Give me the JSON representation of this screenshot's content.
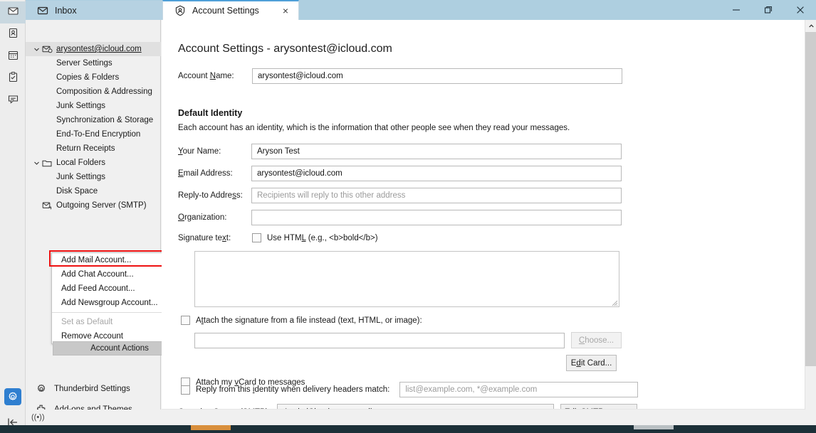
{
  "window": {
    "controls": {
      "minimize": "minimize-icon",
      "maximize": "restore-icon",
      "close": "close-icon"
    }
  },
  "tabs": [
    {
      "label": "Inbox",
      "icon": "inbox-icon",
      "active": false
    },
    {
      "label": "Account Settings",
      "icon": "account-settings-icon",
      "active": true,
      "close": "×"
    }
  ],
  "rail": {
    "top_items": [
      {
        "name": "mail-icon",
        "title": "Mail"
      },
      {
        "name": "address-book-icon",
        "title": "Address Book"
      },
      {
        "name": "calendar-icon",
        "title": "Calendar"
      },
      {
        "name": "tasks-icon",
        "title": "Tasks"
      },
      {
        "name": "chat-icon",
        "title": "Chat"
      }
    ],
    "bottom_items": [
      {
        "name": "settings-gear-icon",
        "title": "Settings"
      },
      {
        "name": "collapse-icon",
        "title": "Collapse"
      }
    ]
  },
  "sidebar": {
    "tree": [
      {
        "label": "arysontest@icloud.com",
        "level": 1,
        "twisty": "v",
        "icon": "account-icon",
        "selected": true,
        "underline": true
      },
      {
        "label": "Server Settings",
        "level": 2
      },
      {
        "label": "Copies & Folders",
        "level": 2
      },
      {
        "label": "Composition & Addressing",
        "level": 2
      },
      {
        "label": "Junk Settings",
        "level": 2
      },
      {
        "label": "Synchronization & Storage",
        "level": 2
      },
      {
        "label": "End-To-End Encryption",
        "level": 2
      },
      {
        "label": "Return Receipts",
        "level": 2
      },
      {
        "label": "Local Folders",
        "level": 1,
        "twisty": "v",
        "icon": "folder-icon"
      },
      {
        "label": "Junk Settings",
        "level": 2
      },
      {
        "label": "Disk Space",
        "level": 2
      },
      {
        "label": "Outgoing Server (SMTP)",
        "level": 1,
        "icon": "smtp-icon"
      }
    ],
    "menu": {
      "items": [
        {
          "label": "Add Mail Account...",
          "accel": "A",
          "disabled": false,
          "highlighted": true
        },
        {
          "label": "Add Chat Account...",
          "accel": "C",
          "disabled": false
        },
        {
          "label": "Add Feed Account...",
          "accel": "F",
          "disabled": false
        },
        {
          "label": "Add Newsgroup Account...",
          "accel": "N",
          "disabled": false
        },
        {
          "separator": true
        },
        {
          "label": "Set as Default",
          "accel": "D",
          "disabled": true
        },
        {
          "label": "Remove Account",
          "accel": "R",
          "disabled": false
        }
      ],
      "highlight_color": "#ee1111"
    },
    "account_actions_button": {
      "label": "Account Actions",
      "caret": "chevron-down-icon"
    },
    "bottom_links": [
      {
        "label": "Thunderbird Settings",
        "icon": "gear-icon"
      },
      {
        "label": "Add-ons and Themes",
        "icon": "puzzle-icon"
      }
    ]
  },
  "main": {
    "heading": "Account Settings - arysontest@icloud.com",
    "account_name": {
      "label_pre": "Account ",
      "label_accel": "N",
      "label_post": "ame:",
      "value": "arysontest@icloud.com"
    },
    "default_identity": {
      "title": "Default Identity",
      "description": "Each account has an identity, which is the information that other people see when they read your messages.",
      "fields": [
        {
          "label_pre": "",
          "label_accel": "Y",
          "label_post": "our Name:",
          "value": "Aryson Test",
          "placeholder": ""
        },
        {
          "label_pre": "",
          "label_accel": "E",
          "label_post": "mail Address:",
          "value": "arysontest@icloud.com",
          "placeholder": ""
        },
        {
          "label_pre": "Reply-to Addre",
          "label_accel": "s",
          "label_post": "s:",
          "value": "",
          "placeholder": "Recipients will reply to this other address"
        },
        {
          "label_pre": "",
          "label_accel": "O",
          "label_post": "rganization:",
          "value": "",
          "placeholder": ""
        }
      ],
      "signature": {
        "label_pre": "Signature te",
        "label_accel": "x",
        "label_post": "t:",
        "use_html_pre": "Use HTM",
        "use_html_accel": "L",
        "use_html_post": " (e.g., <b>bold</b>)",
        "use_html_checked": false,
        "textarea_value": ""
      },
      "attach_file": {
        "label_pre": "A",
        "label_accel": "t",
        "label_post": "tach the signature from a file instead (text, HTML, or image):",
        "checked": false,
        "path_value": "",
        "choose_button": {
          "label_pre": "",
          "label_accel": "C",
          "label_post": "hoose...",
          "disabled": true
        }
      },
      "attach_vcard": {
        "label_pre": "Attach my ",
        "label_accel": "v",
        "label_post": "Card to messages",
        "checked": false,
        "edit_card_button": {
          "label_pre": "E",
          "label_accel": "d",
          "label_post": "it Card..."
        }
      },
      "reply_identity": {
        "label_pre": "Reply from this ",
        "label_accel": "i",
        "label_post": "dentity when delivery headers match:",
        "checked": false,
        "value": "",
        "placeholder": "list@example.com, *@example.com"
      },
      "outgoing_server": {
        "label_pre": "O",
        "label_accel": "u",
        "label_post": "tgoing Server (SMTP):",
        "selected": "Apple iCloud - smtp.mail.me.com",
        "caret": "chevron-down-icon",
        "edit_button": {
          "label_pre": "Edit SMT",
          "label_accel": "P",
          "label_post": " server..."
        }
      }
    }
  },
  "scrollbar": {
    "up": "chevron-up-icon",
    "down": "chevron-down-icon"
  },
  "statusbar": {
    "indicator": "((•))"
  },
  "colors": {
    "titlebar": "#aecfe0",
    "accent_blue": "#3b8fd4",
    "highlight_red": "#ee1111",
    "sidebar_bg": "#f0f0f0",
    "selected_row": "#e0e0e0"
  }
}
